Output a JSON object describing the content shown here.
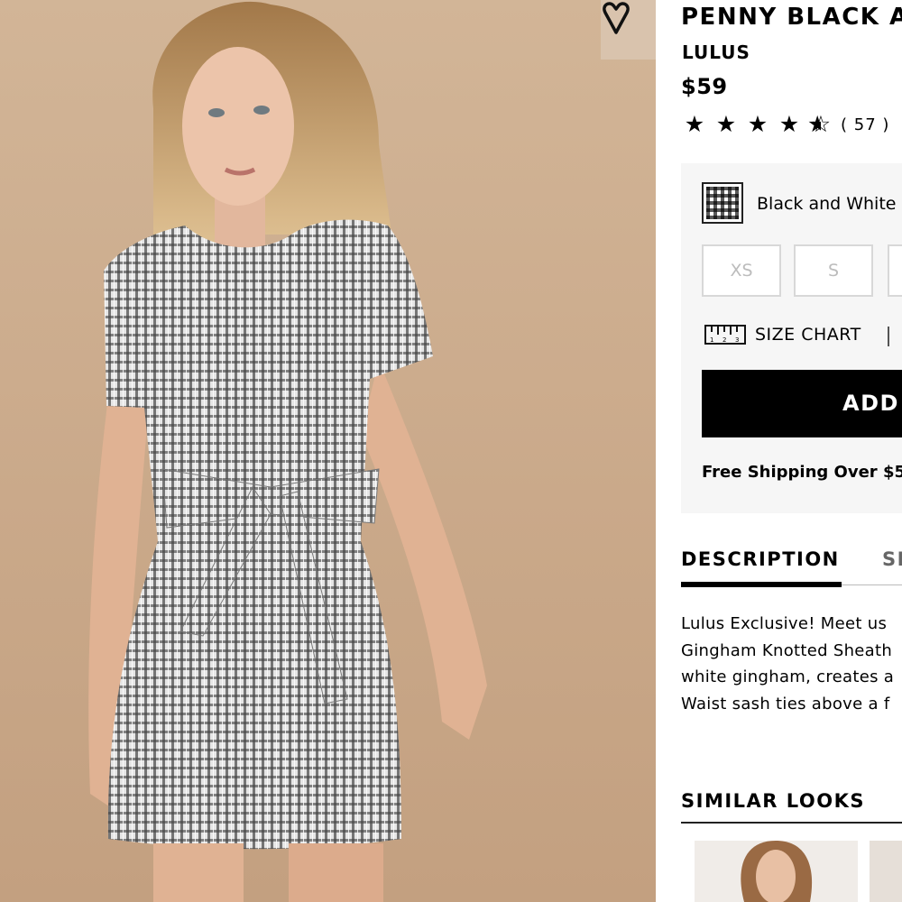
{
  "product": {
    "title": "PENNY BLACK A",
    "brand": "LULUS",
    "price": "$59",
    "rating": 4.5,
    "review_count": "( 57 )"
  },
  "hero": {
    "image_icon": "model-photo",
    "wishlist_icon": "heart-icon"
  },
  "options": {
    "color_label": "Black and White",
    "color_icon": "gingham-swatch",
    "sizes": [
      "XS",
      "S",
      ""
    ],
    "size_chart_label": "SIZE CHART",
    "size_chart_icon": "ruler-icon"
  },
  "cart": {
    "add_label": "ADD",
    "shipping_text": "Free Shipping Over $5"
  },
  "tabs": {
    "description": "DESCRIPTION",
    "next": "SI"
  },
  "description_lines": [
    "Lulus Exclusive! Meet us",
    "Gingham Knotted Sheath",
    "white gingham, creates a",
    "Waist sash ties above a f"
  ],
  "similar": {
    "heading": "SIMILAR LOOKS"
  },
  "colors": {
    "accent": "#000000",
    "panel": "#f6f6f6",
    "hero_bg": "#cdb092"
  }
}
